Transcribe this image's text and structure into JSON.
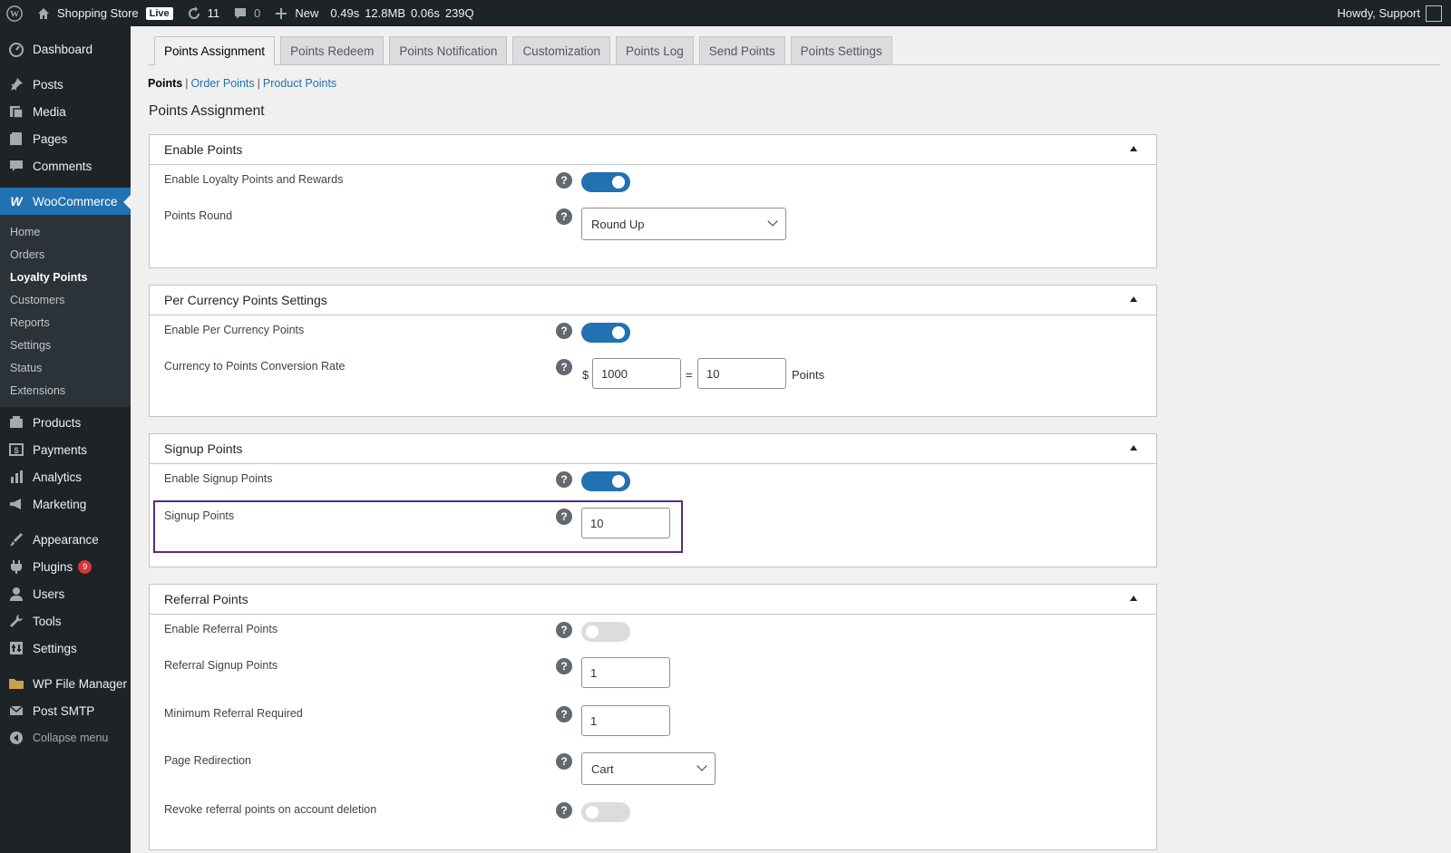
{
  "adminbar": {
    "site_name": "Shopping Store",
    "live_label": "Live",
    "updates_count": "11",
    "comments_count": "0",
    "new_label": "New",
    "perf": [
      "0.49s",
      "12.8MB",
      "0.06s",
      "239Q"
    ],
    "greeting": "Howdy, Support"
  },
  "sidebar": {
    "items_top": [
      {
        "label": "Dashboard",
        "icon": "dashboard-icon"
      }
    ],
    "items_content": [
      {
        "label": "Posts",
        "icon": "pin-icon"
      },
      {
        "label": "Media",
        "icon": "media-icon"
      },
      {
        "label": "Pages",
        "icon": "pages-icon"
      },
      {
        "label": "Comments",
        "icon": "comment-icon"
      }
    ],
    "woocommerce": "WooCommerce",
    "woo_sub": [
      {
        "label": "Home"
      },
      {
        "label": "Orders"
      },
      {
        "label": "Loyalty Points",
        "active": true
      },
      {
        "label": "Customers"
      },
      {
        "label": "Reports"
      },
      {
        "label": "Settings"
      },
      {
        "label": "Status"
      },
      {
        "label": "Extensions"
      }
    ],
    "items_shop": [
      {
        "label": "Products",
        "icon": "products-icon"
      },
      {
        "label": "Payments",
        "icon": "payments-icon"
      },
      {
        "label": "Analytics",
        "icon": "analytics-icon"
      },
      {
        "label": "Marketing",
        "icon": "marketing-icon"
      }
    ],
    "items_admin": [
      {
        "label": "Appearance",
        "icon": "brush-icon"
      },
      {
        "label": "Plugins",
        "icon": "plugin-icon",
        "badge": "9"
      },
      {
        "label": "Users",
        "icon": "user-icon"
      },
      {
        "label": "Tools",
        "icon": "wrench-icon"
      },
      {
        "label": "Settings",
        "icon": "settings-icon"
      }
    ],
    "items_extra": [
      {
        "label": "WP File Manager",
        "icon": "folder-icon"
      },
      {
        "label": "Post SMTP",
        "icon": "mail-icon"
      }
    ],
    "collapse": "Collapse menu"
  },
  "tabs": [
    "Points Assignment",
    "Points Redeem",
    "Points Notification",
    "Customization",
    "Points Log",
    "Send Points",
    "Points Settings"
  ],
  "subsub": {
    "current": "Points",
    "links": [
      "Order Points",
      "Product Points"
    ]
  },
  "page_title": "Points Assignment",
  "sections": {
    "enable_points": {
      "title": "Enable Points",
      "enable_label": "Enable Loyalty Points and Rewards",
      "enable_on": true,
      "round_label": "Points Round",
      "round_value": "Round Up"
    },
    "per_currency": {
      "title": "Per Currency Points Settings",
      "enable_label": "Enable Per Currency Points",
      "enable_on": true,
      "rate_label": "Currency to Points Conversion Rate",
      "currency_symbol": "$",
      "currency_value": "1000",
      "equals": "=",
      "points_value": "10",
      "points_unit": "Points"
    },
    "signup": {
      "title": "Signup Points",
      "enable_label": "Enable Signup Points",
      "enable_on": true,
      "points_label": "Signup Points",
      "points_value": "10"
    },
    "referral": {
      "title": "Referral Points",
      "enable_label": "Enable Referral Points",
      "enable_on": false,
      "signup_label": "Referral Signup Points",
      "signup_value": "1",
      "min_label": "Minimum Referral Required",
      "min_value": "1",
      "redirect_label": "Page Redirection",
      "redirect_value": "Cart",
      "revoke_label": "Revoke referral points on account deletion",
      "revoke_on": false
    }
  },
  "colors": {
    "accent": "#2271b1",
    "highlight": "#5b2a86",
    "sidebar": "#1d2327"
  }
}
